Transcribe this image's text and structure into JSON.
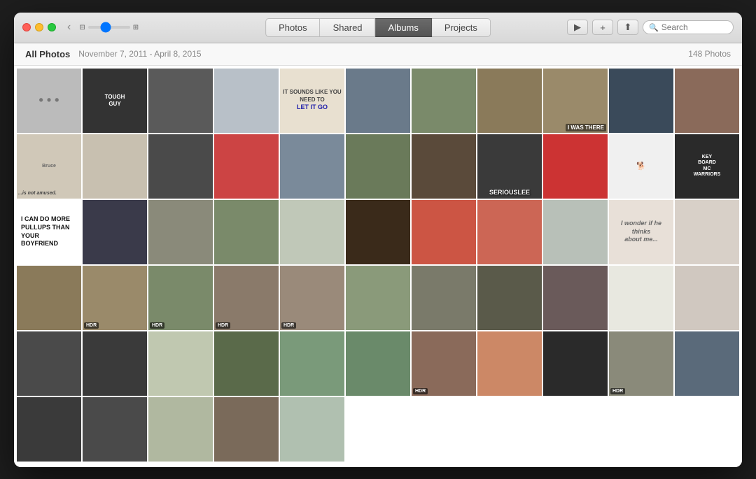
{
  "window": {
    "title": "Photos"
  },
  "titlebar": {
    "traffic_lights": [
      "close",
      "minimize",
      "maximize"
    ],
    "back_label": "‹",
    "tabs": [
      {
        "id": "photos",
        "label": "Photos",
        "active": false
      },
      {
        "id": "shared",
        "label": "Shared",
        "active": false
      },
      {
        "id": "albums",
        "label": "Albums",
        "active": true
      },
      {
        "id": "projects",
        "label": "Projects",
        "active": false
      }
    ],
    "toolbar_buttons": [
      "▶",
      "+",
      "⬆"
    ],
    "search_placeholder": "Search"
  },
  "subtitle": {
    "all_photos": "All Photos",
    "date_range": "November 7, 2011 - April 8, 2015",
    "photo_count": "148 Photos"
  },
  "photos": {
    "count": 148,
    "thumbnails": [
      {
        "id": 1,
        "color": "c14",
        "text": "• • •",
        "row": 1
      },
      {
        "id": 2,
        "color": "c2",
        "text": "TOUGH GUY",
        "row": 1
      },
      {
        "id": 3,
        "color": "c7",
        "text": "",
        "row": 1
      },
      {
        "id": 4,
        "color": "c36",
        "text": "",
        "row": 1
      },
      {
        "id": 5,
        "color": "c19",
        "text": "",
        "row": 1
      },
      {
        "id": 6,
        "color": "c6",
        "text": "",
        "row": 1
      },
      {
        "id": 7,
        "color": "c11",
        "text": "",
        "row": 1
      },
      {
        "id": 8,
        "color": "c5",
        "text": "",
        "row": 1
      },
      {
        "id": 9,
        "color": "c8",
        "text": "",
        "row": 1
      },
      {
        "id": 10,
        "color": "c13",
        "text": "",
        "row": 1
      },
      {
        "id": 11,
        "color": "c1",
        "text": "",
        "row": 1
      }
    ]
  }
}
